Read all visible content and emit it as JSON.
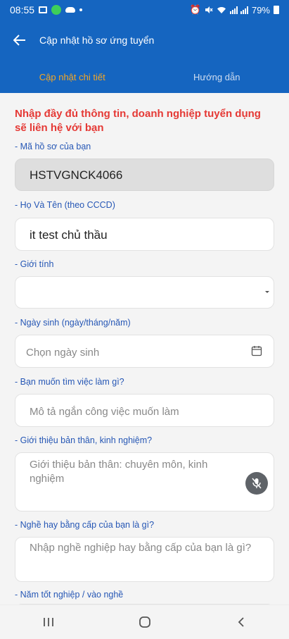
{
  "status": {
    "time": "08:55",
    "battery": "79%"
  },
  "app_bar": {
    "title": "Cập nhật hồ sơ ứng tuyển"
  },
  "tabs": [
    {
      "label": "Cập nhật chi tiết",
      "active": true
    },
    {
      "label": "Hướng dẫn",
      "active": false
    }
  ],
  "form": {
    "notice": "Nhập đầy đủ thông tin, doanh nghiệp tuyển dụng sẽ liên hệ với bạn",
    "profile_code": {
      "label": "- Mã hồ sơ của bạn",
      "value": "HSTVGNCK4066"
    },
    "full_name": {
      "label": "- Họ Và Tên (theo CCCD)",
      "value": "it test chủ thầu"
    },
    "gender": {
      "label": "- Giới tính",
      "value": ""
    },
    "birthday": {
      "label": "- Ngày sinh (ngày/tháng/năm)",
      "placeholder": "Chọn ngày sinh"
    },
    "job_wanted": {
      "label": "- Bạn muốn tìm việc làm gì?",
      "placeholder": "Mô tả ngắn công việc muốn làm"
    },
    "intro": {
      "label": "- Giới thiệu bản thân, kinh nghiệm?",
      "placeholder": "Giới thiệu bản thân: chuyên môn, kinh nghiệm"
    },
    "degree": {
      "label": "- Nghề hay bằng cấp của bạn là gì?",
      "placeholder": "Nhập nghề nghiệp hay bằng cấp của bạn là gì?"
    },
    "grad_year": {
      "label": "- Năm tốt nghiệp / vào nghề"
    }
  },
  "colors": {
    "primary": "#1565c0",
    "accent": "#f5a623",
    "notice": "#e53935",
    "label": "#2657b5"
  }
}
